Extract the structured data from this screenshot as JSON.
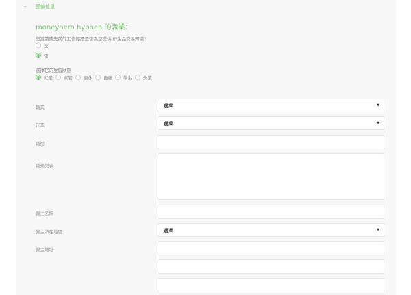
{
  "section": {
    "collapse_symbol": "–",
    "title": "受僱信息"
  },
  "heading": "moneyhero hyphen 的職業：",
  "derivative_question": {
    "text": "您當前或先前的工作經歷是否為您提供 衍生品交易知識?",
    "options": [
      {
        "label": "是",
        "selected": false
      },
      {
        "label": "否",
        "selected": true
      }
    ]
  },
  "employment_status": {
    "label": "選擇您的受僱狀態",
    "options": [
      {
        "label": "就業",
        "selected": true
      },
      {
        "label": "家管",
        "selected": false
      },
      {
        "label": "退休",
        "selected": false
      },
      {
        "label": "自雇",
        "selected": false
      },
      {
        "label": "學生",
        "selected": false
      },
      {
        "label": "失業",
        "selected": false
      }
    ]
  },
  "fields": {
    "occupation": {
      "label": "職業",
      "value": "選擇"
    },
    "industry": {
      "label": "行業",
      "value": "選擇"
    },
    "position": {
      "label": "職銜",
      "value": ""
    },
    "duties": {
      "label": "職務列表",
      "value": ""
    },
    "employer_name": {
      "label": "僱主名稱",
      "value": ""
    },
    "employer_region": {
      "label": "僱主所在地區",
      "value": "選擇"
    },
    "employer_address": {
      "label": "僱主地址",
      "value": ""
    }
  },
  "icons": {
    "dropdown": "▼"
  },
  "colors": {
    "accent": "#7cc576",
    "panel_bg": "#f7f7f7"
  }
}
